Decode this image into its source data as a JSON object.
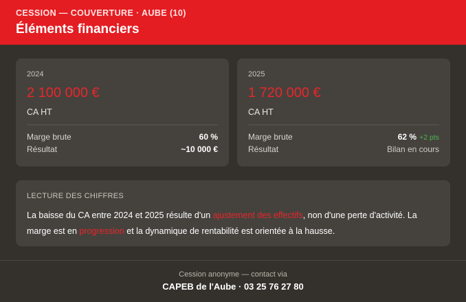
{
  "header": {
    "eyebrow": "CESSION — COUVERTURE · AUBE (10)",
    "title": "Éléments financiers"
  },
  "cards": [
    {
      "year": "2024",
      "amount": "2 100 000 €",
      "caption": "CA HT",
      "rows": [
        {
          "label": "Marge brute",
          "value": "60 %",
          "delta": ""
        },
        {
          "label": "Résultat",
          "value": "~10 000 €",
          "delta": ""
        }
      ]
    },
    {
      "year": "2025",
      "amount": "1 720 000 €",
      "caption": "CA HT",
      "rows": [
        {
          "label": "Marge brute",
          "value": "62 %",
          "delta": "+2 pts"
        },
        {
          "label": "Résultat",
          "value": "Bilan en cours",
          "delta": ""
        }
      ]
    }
  ],
  "lecture": {
    "label": "LECTURE DES CHIFFRES",
    "text_1": "La baisse du CA entre 2024 et 2025 résulte d'un ",
    "highlight_1": "ajustement des effectifs",
    "text_2": ", non d'une perte d'activité. La marge est en ",
    "highlight_2": "progression",
    "text_3": " et la dynamique de rentabilité est orientée à la hausse."
  },
  "footer": {
    "line1": "Cession anonyme — contact via",
    "line2": "CAPEB de l'Aube · 03 25 76 27 80"
  },
  "colors": {
    "brand_red": "#e41d22",
    "amount_red": "#e8262b",
    "positive_green": "#4cb651",
    "background": "#34312c",
    "card": "#45423d"
  }
}
